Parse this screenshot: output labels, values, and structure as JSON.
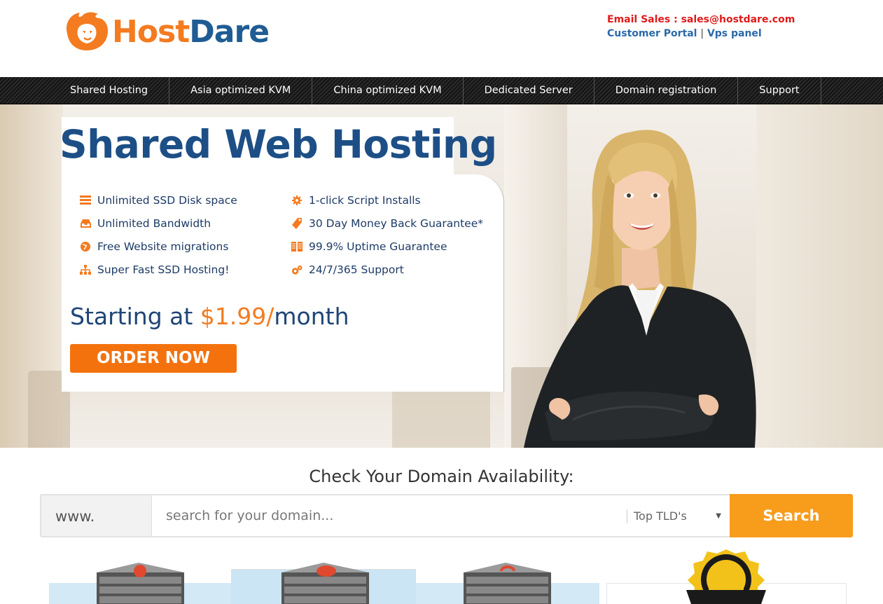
{
  "header": {
    "logo": {
      "host": "Host",
      "dare": "Dare"
    },
    "contact": {
      "sales": "Email Sales : sales@hostdare.com",
      "customer_portal": "Customer Portal",
      "separator": "|",
      "vps_panel": "Vps panel"
    }
  },
  "nav": {
    "items": [
      {
        "label": "Shared Hosting"
      },
      {
        "label": "Asia optimized KVM"
      },
      {
        "label": "China optimized KVM"
      },
      {
        "label": "Dedicated Server"
      },
      {
        "label": "Domain registration"
      },
      {
        "label": "Support"
      }
    ]
  },
  "hero": {
    "title": "Shared Web Hosting",
    "features_left": [
      {
        "icon": "storage-icon",
        "label": "Unlimited SSD Disk space"
      },
      {
        "icon": "inbox-icon",
        "label": "Unlimited Bandwidth"
      },
      {
        "icon": "globe-icon",
        "label": "Free Website migrations"
      },
      {
        "icon": "sitemap-icon",
        "label": "Super Fast SSD Hosting!"
      }
    ],
    "features_right": [
      {
        "icon": "gear-icon",
        "label": "1-click Script Installs"
      },
      {
        "icon": "tag-icon",
        "label": "30 Day Money Back Guarantee*"
      },
      {
        "icon": "server-rack-icon",
        "label": "99.9% Uptime Guarantee"
      },
      {
        "icon": "cogs-icon",
        "label": "24/7/365 Support"
      }
    ],
    "price_prefix": "Starting at ",
    "price_amount": "$1.99/",
    "price_suffix": "month",
    "order_button": "ORDER NOW"
  },
  "domain": {
    "title": "Check Your Domain Availability:",
    "prefix": "www.",
    "placeholder": "search for your domain...",
    "tld_selected": "Top TLD's",
    "search_button": "Search"
  },
  "colors": {
    "brand_orange": "#f47b20",
    "brand_blue": "#1d4f86",
    "search_orange": "#f89c1c",
    "sales_red": "#e01a1a"
  }
}
